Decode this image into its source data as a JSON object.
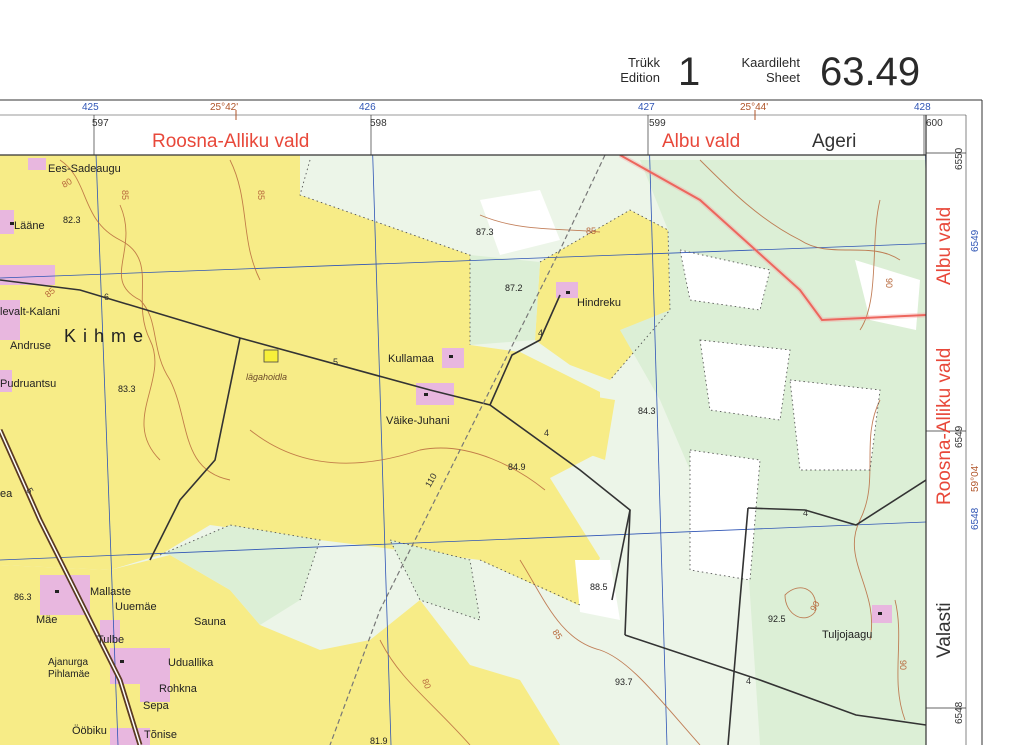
{
  "header": {
    "edition_label_et": "Trükk",
    "edition_label_en": "Edition",
    "edition_number": "1",
    "sheet_label_et": "Kaardileht",
    "sheet_label_en": "Sheet",
    "sheet_number": "63.49"
  },
  "frame": {
    "top_grid_km": [
      "425",
      "426",
      "427",
      "428"
    ],
    "top_longitudes": [
      "25°42'",
      "25°44'"
    ],
    "top_ticks": [
      "597",
      "598",
      "599",
      "600"
    ],
    "right_grid_km": [
      "6549",
      "6548"
    ],
    "right_ticks": [
      "6550",
      "6549",
      "6548"
    ],
    "right_latitude": "59°04'"
  },
  "regions": {
    "roosna_alliku_top": "Roosna-Alliku vald",
    "albu_top": "Albu vald",
    "ageri": "Ageri",
    "albu_side": "Albu vald",
    "roosna_alliku_side": "Roosna-Alliku vald",
    "valasti": "Valasti"
  },
  "places": {
    "ees_sadeaugu": "Ees-Sadeaugu",
    "laane": "Lääne",
    "levalt_kalani": "levalt-Kalani",
    "kihme": "K i h m e",
    "andruse": "Andruse",
    "pudruantsu": "Pudruantsu",
    "lagahoidla": "lägahoidla",
    "kullamaa": "Kullamaa",
    "vaike_juhani": "Väike-Juhani",
    "hindreku": "Hindreku",
    "mallaste": "Mallaste",
    "uuemae": "Uuemäe",
    "mae": "Mäe",
    "sauna": "Sauna",
    "tulbe": "Tulbe",
    "ajanurga": "Ajanurga",
    "pihlamae": "Pihlamäe",
    "uduallika": "Uduallika",
    "rohkna": "Rohkna",
    "sepa": "Sepa",
    "oobiku": "Ööbiku",
    "tonise": "Tõnise",
    "tuljojaagu": "Tuljojaagu",
    "ea": "ea"
  },
  "spot_heights": [
    "82.3",
    "87.3",
    "87.2",
    "83.3",
    "84.3",
    "84.9",
    "88.5",
    "92.5",
    "93.7",
    "86.3",
    "81.9"
  ],
  "contour_labels": [
    "80",
    "85",
    "85",
    "85",
    "85",
    "90",
    "90",
    "90",
    "80",
    "85"
  ],
  "road_numbers": [
    "6",
    "5",
    "4",
    "4",
    "4",
    "4",
    "110",
    "5"
  ],
  "colors": {
    "field": "#f7ec87",
    "grass": "#dcefd6",
    "forest_light": "#ecf5e8",
    "settlement": "#e8b7df",
    "boundary_red": "#e8483a",
    "grid_blue": "#2f55b5",
    "contour": "#b86a3e"
  }
}
